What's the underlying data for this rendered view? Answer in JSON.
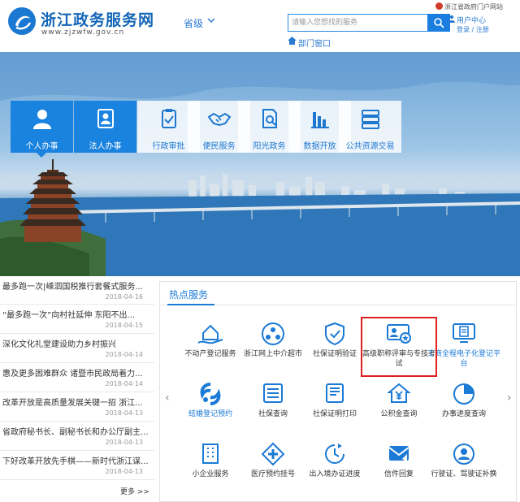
{
  "header": {
    "site_title": "浙江政务服务网",
    "site_url": "www.zjzwfw.gov.cn",
    "province_label": "省级",
    "search_placeholder": "请输入您想找的服务",
    "portal_link": "浙江省政府门户网站",
    "user_center": "用户中心",
    "login_links": "登录 / 注册",
    "dept_window": "部门窗口"
  },
  "nav": [
    {
      "label": "个人办事",
      "icon": "person-icon"
    },
    {
      "label": "法人办事",
      "icon": "corporate-icon"
    },
    {
      "label": "行政审批",
      "icon": "clipboard-check-icon"
    },
    {
      "label": "便民服务",
      "icon": "handshake-icon"
    },
    {
      "label": "阳光政务",
      "icon": "document-search-icon"
    },
    {
      "label": "数据开放",
      "icon": "bar-chart-icon"
    },
    {
      "label": "公共资源交易",
      "icon": "server-stack-icon"
    }
  ],
  "news": [
    {
      "title": "最多跑一次|嵊泗国税推行套餐式服务...",
      "date": "2018-04-16"
    },
    {
      "title": "“最多跑一次”向村社延伸 东阳不出...",
      "date": "2018-04-15"
    },
    {
      "title": "深化文化礼堂建设助力乡村振兴",
      "date": "2018-04-14"
    },
    {
      "title": "惠及更多困难群众 诸暨市民政局着力...",
      "date": "2018-04-14"
    },
    {
      "title": "改革开放是高质量发展关键一招 浙江...",
      "date": "2018-04-13"
    },
    {
      "title": "省政府秘书长、副秘书长和办公厅副主...",
      "date": "2018-04-13"
    },
    {
      "title": "下好改革开放先手棋——新时代浙江谋...",
      "date": "2018-04-13"
    }
  ],
  "news_more": "更多 >>",
  "hot": {
    "title": "热点服务",
    "services": [
      {
        "label": "不动产登记服务",
        "icon": "house-hand-icon"
      },
      {
        "label": "浙江网上中介超市",
        "icon": "people-network-icon"
      },
      {
        "label": "社保证明验证",
        "icon": "shield-check-icon"
      },
      {
        "label": "高级职称评审与专技考试",
        "icon": "id-card-star-icon"
      },
      {
        "label": "工商全程电子化登记平台",
        "icon": "monitor-doc-icon"
      },
      {
        "label": "结婚登记预约",
        "icon": "double-ring-icon"
      },
      {
        "label": "社保查询",
        "icon": "list-search-icon"
      },
      {
        "label": "社保证明打印",
        "icon": "printer-doc-icon"
      },
      {
        "label": "公积金查询",
        "icon": "house-yen-icon"
      },
      {
        "label": "办事进度查询",
        "icon": "progress-pie-icon"
      },
      {
        "label": "小企业服务",
        "icon": "building-icon"
      },
      {
        "label": "医疗预约挂号",
        "icon": "medical-cross-icon"
      },
      {
        "label": "出入境办证进度",
        "icon": "clock-arrow-icon"
      },
      {
        "label": "信件回复",
        "icon": "mail-reply-icon"
      },
      {
        "label": "行驶证、驾驶证补换",
        "icon": "driver-license-icon"
      }
    ]
  },
  "colors": {
    "accent": "#1a7ad6",
    "primary_tile": "#1a82df",
    "highlight": "#e02020"
  }
}
